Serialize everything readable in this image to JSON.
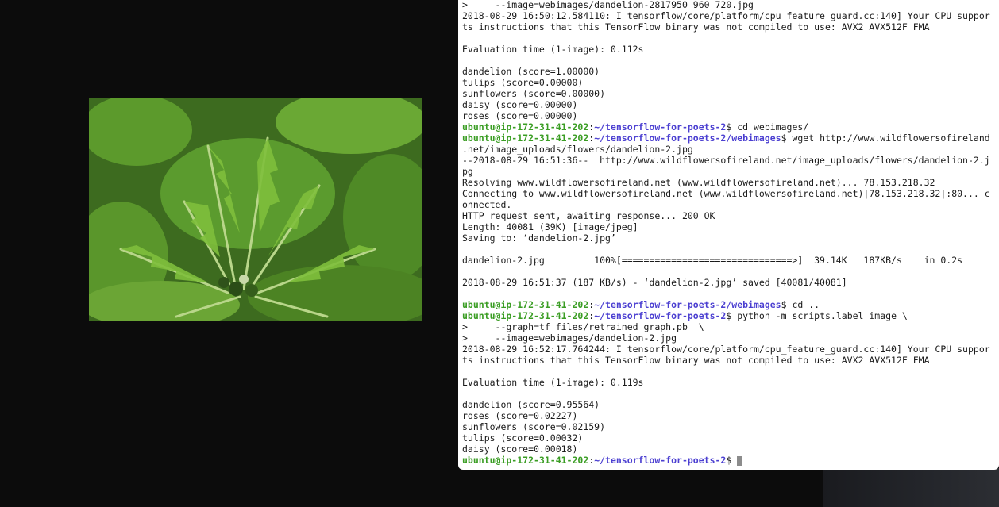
{
  "terminal": {
    "lines": [
      {
        "kind": "text",
        "text": ">     --image=webimages/dandelion-2817950_960_720.jpg"
      },
      {
        "kind": "text",
        "text": "2018-08-29 16:50:12.584110: I tensorflow/core/platform/cpu_feature_guard.cc:140] Your CPU suppor"
      },
      {
        "kind": "text",
        "text": "ts instructions that this TensorFlow binary was not compiled to use: AVX2 AVX512F FMA"
      },
      {
        "kind": "text",
        "text": ""
      },
      {
        "kind": "text",
        "text": "Evaluation time (1-image): 0.112s"
      },
      {
        "kind": "text",
        "text": ""
      },
      {
        "kind": "text",
        "text": "dandelion (score=1.00000)"
      },
      {
        "kind": "text",
        "text": "tulips (score=0.00000)"
      },
      {
        "kind": "text",
        "text": "sunflowers (score=0.00000)"
      },
      {
        "kind": "text",
        "text": "daisy (score=0.00000)"
      },
      {
        "kind": "text",
        "text": "roses (score=0.00000)"
      },
      {
        "kind": "prompt",
        "host": "ubuntu@ip-172-31-41-202",
        "path": "~/tensorflow-for-poets-2",
        "sym": "$ ",
        "cmd": "cd webimages/"
      },
      {
        "kind": "prompt",
        "host": "ubuntu@ip-172-31-41-202",
        "path": "~/tensorflow-for-poets-2/webimages",
        "sym": "$ ",
        "cmd": "wget http://www.wildflowersofireland"
      },
      {
        "kind": "text",
        "text": ".net/image_uploads/flowers/dandelion-2.jpg"
      },
      {
        "kind": "text",
        "text": "--2018-08-29 16:51:36--  http://www.wildflowersofireland.net/image_uploads/flowers/dandelion-2.j"
      },
      {
        "kind": "text",
        "text": "pg"
      },
      {
        "kind": "text",
        "text": "Resolving www.wildflowersofireland.net (www.wildflowersofireland.net)... 78.153.218.32"
      },
      {
        "kind": "text",
        "text": "Connecting to www.wildflowersofireland.net (www.wildflowersofireland.net)|78.153.218.32|:80... c"
      },
      {
        "kind": "text",
        "text": "onnected."
      },
      {
        "kind": "text",
        "text": "HTTP request sent, awaiting response... 200 OK"
      },
      {
        "kind": "text",
        "text": "Length: 40081 (39K) [image/jpeg]"
      },
      {
        "kind": "text",
        "text": "Saving to: ‘dandelion-2.jpg’"
      },
      {
        "kind": "text",
        "text": ""
      },
      {
        "kind": "text",
        "text": "dandelion-2.jpg         100%[===============================>]  39.14K   187KB/s    in 0.2s"
      },
      {
        "kind": "text",
        "text": ""
      },
      {
        "kind": "text",
        "text": "2018-08-29 16:51:37 (187 KB/s) - ‘dandelion-2.jpg’ saved [40081/40081]"
      },
      {
        "kind": "text",
        "text": ""
      },
      {
        "kind": "prompt",
        "host": "ubuntu@ip-172-31-41-202",
        "path": "~/tensorflow-for-poets-2/webimages",
        "sym": "$ ",
        "cmd": "cd .."
      },
      {
        "kind": "prompt",
        "host": "ubuntu@ip-172-31-41-202",
        "path": "~/tensorflow-for-poets-2",
        "sym": "$ ",
        "cmd": "python -m scripts.label_image \\"
      },
      {
        "kind": "text",
        "text": ">     --graph=tf_files/retrained_graph.pb  \\"
      },
      {
        "kind": "text",
        "text": ">     --image=webimages/dandelion-2.jpg"
      },
      {
        "kind": "text",
        "text": "2018-08-29 16:52:17.764244: I tensorflow/core/platform/cpu_feature_guard.cc:140] Your CPU suppor"
      },
      {
        "kind": "text",
        "text": "ts instructions that this TensorFlow binary was not compiled to use: AVX2 AVX512F FMA"
      },
      {
        "kind": "text",
        "text": ""
      },
      {
        "kind": "text",
        "text": "Evaluation time (1-image): 0.119s"
      },
      {
        "kind": "text",
        "text": ""
      },
      {
        "kind": "text",
        "text": "dandelion (score=0.95564)"
      },
      {
        "kind": "text",
        "text": "roses (score=0.02227)"
      },
      {
        "kind": "text",
        "text": "sunflowers (score=0.02159)"
      },
      {
        "kind": "text",
        "text": "tulips (score=0.00032)"
      },
      {
        "kind": "text",
        "text": "daisy (score=0.00018)"
      },
      {
        "kind": "prompt",
        "host": "ubuntu@ip-172-31-41-202",
        "path": "~/tensorflow-for-poets-2",
        "sym": "$ ",
        "cmd": "",
        "cursor": true
      }
    ]
  },
  "colors": {
    "prompt_host": "#3a9d23",
    "prompt_path": "#4b3fd1",
    "terminal_bg": "#ffffff",
    "desktop_bg": "#0c0c0c"
  },
  "preview": {
    "subject_icon": "dandelion-leaves-photo"
  }
}
